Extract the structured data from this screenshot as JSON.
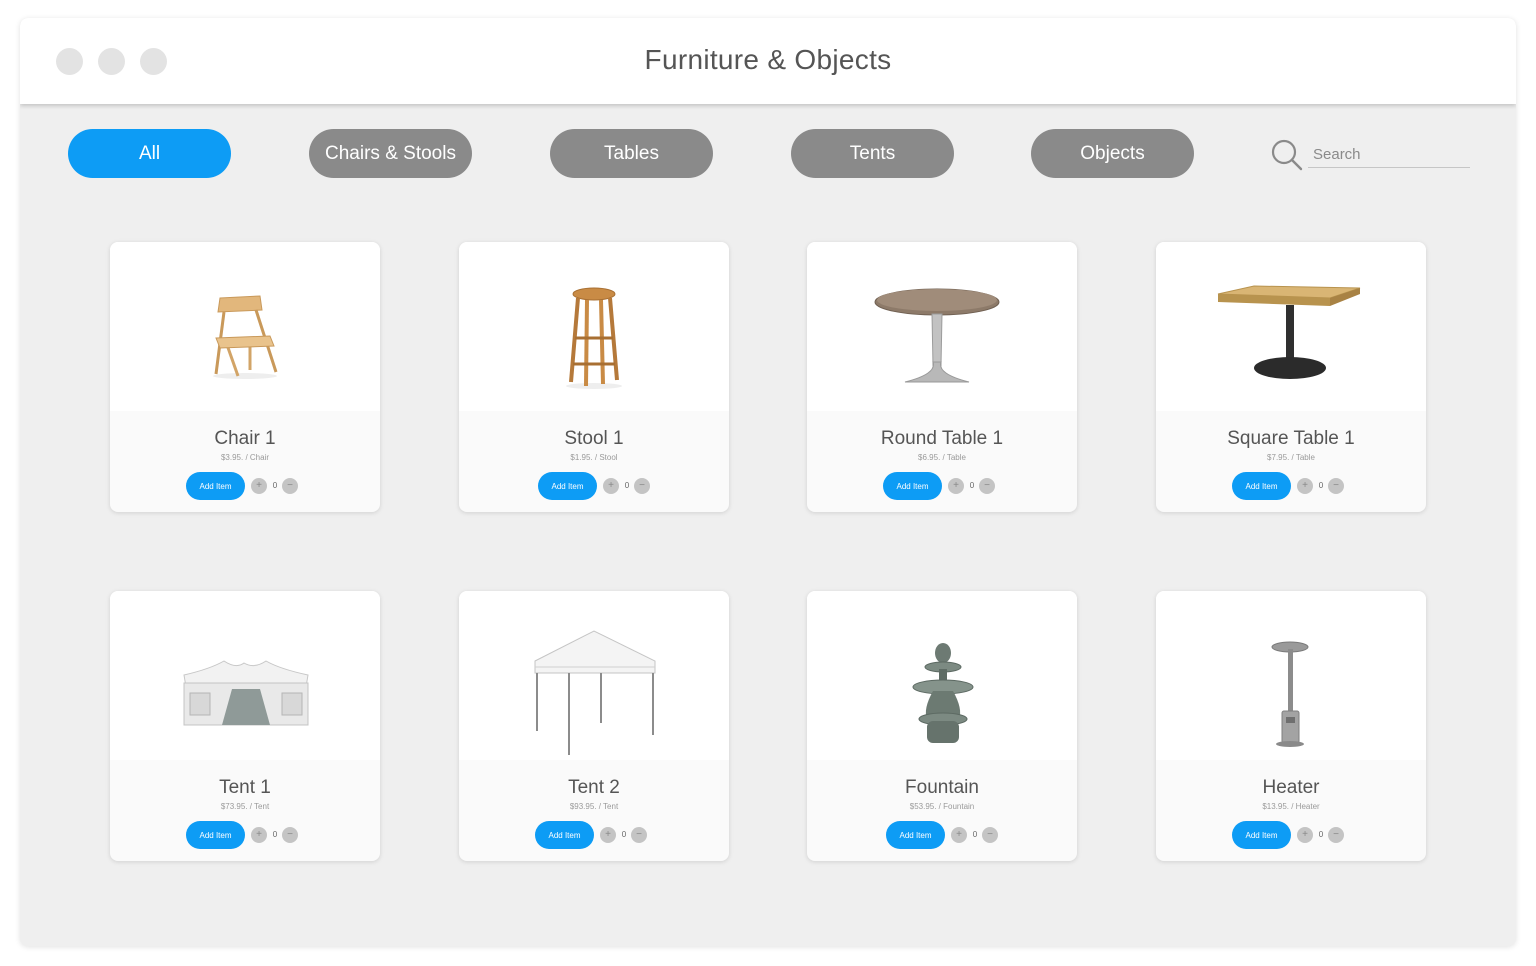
{
  "window": {
    "title": "Furniture & Objects"
  },
  "filters": [
    {
      "label": "All",
      "active": true
    },
    {
      "label": "Chairs & Stools",
      "active": false
    },
    {
      "label": "Tables",
      "active": false
    },
    {
      "label": "Tents",
      "active": false
    },
    {
      "label": "Objects",
      "active": false
    }
  ],
  "search": {
    "placeholder": "Search",
    "value": ""
  },
  "products": [
    {
      "name": "Chair 1",
      "price": "$3.95. / Chair",
      "button": "Add Item",
      "plus": "+",
      "minus": "−",
      "qty": "0",
      "icon": "folding-chair-icon"
    },
    {
      "name": "Stool 1",
      "price": "$1.95. / Stool",
      "button": "Add Item",
      "plus": "+",
      "minus": "−",
      "qty": "0",
      "icon": "bar-stool-icon"
    },
    {
      "name": "Round Table 1",
      "price": "$6.95. / Table",
      "button": "Add Item",
      "plus": "+",
      "minus": "−",
      "qty": "0",
      "icon": "round-table-icon"
    },
    {
      "name": "Square Table 1",
      "price": "$7.95. / Table",
      "button": "Add Item",
      "plus": "+",
      "minus": "−",
      "qty": "0",
      "icon": "square-table-icon"
    },
    {
      "name": "Tent 1",
      "price": "$73.95. / Tent",
      "button": "Add Item",
      "plus": "+",
      "minus": "−",
      "qty": "0",
      "icon": "party-tent-icon"
    },
    {
      "name": "Tent 2",
      "price": "$93.95. / Tent",
      "button": "Add Item",
      "plus": "+",
      "minus": "−",
      "qty": "0",
      "icon": "canopy-tent-icon"
    },
    {
      "name": "Fountain",
      "price": "$53.95. / Fountain",
      "button": "Add Item",
      "plus": "+",
      "minus": "−",
      "qty": "0",
      "icon": "fountain-icon"
    },
    {
      "name": "Heater",
      "price": "$13.95. / Heater",
      "button": "Add Item",
      "plus": "+",
      "minus": "−",
      "qty": "0",
      "icon": "patio-heater-icon"
    }
  ],
  "colors": {
    "accent": "#0d9cf5",
    "pill": "#8a8a8a",
    "background": "#efefef"
  }
}
